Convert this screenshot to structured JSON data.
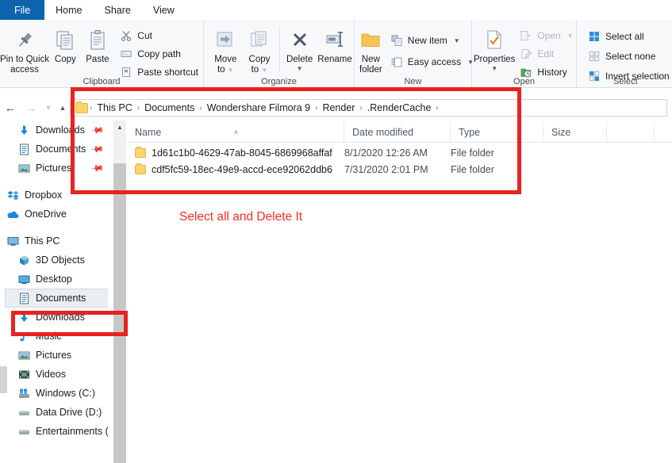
{
  "window": {
    "tabs": [
      {
        "label": "File",
        "kind": "file"
      },
      {
        "label": "Home",
        "kind": "active"
      },
      {
        "label": "Share",
        "kind": "normal"
      },
      {
        "label": "View",
        "kind": "normal"
      }
    ]
  },
  "ribbon": {
    "groups": {
      "clipboard": {
        "label": "Clipboard",
        "pin_to_quick_access_line1": "Pin to Quick",
        "pin_to_quick_access_line2": "access",
        "copy": "Copy",
        "paste": "Paste",
        "cut": "Cut",
        "copy_path": "Copy path",
        "paste_shortcut": "Paste shortcut"
      },
      "organize": {
        "label": "Organize",
        "move_to_line1": "Move",
        "move_to_line2": "to",
        "copy_to_line1": "Copy",
        "copy_to_line2": "to",
        "delete": "Delete",
        "rename": "Rename"
      },
      "new": {
        "label": "New",
        "new_folder_line1": "New",
        "new_folder_line2": "folder",
        "new_item": "New item",
        "easy_access": "Easy access"
      },
      "open": {
        "label": "Open",
        "properties": "Properties",
        "open": "Open",
        "edit": "Edit",
        "history": "History"
      },
      "select": {
        "label": "Select",
        "select_all": "Select all",
        "select_none": "Select none",
        "invert_selection": "Invert selection"
      }
    }
  },
  "address_bar": {
    "breadcrumbs": [
      "This PC",
      "Documents",
      "Wondershare Filmora 9",
      "Render",
      ".RenderCache"
    ],
    "separator": "›"
  },
  "columns": {
    "name": "Name",
    "date_modified": "Date modified",
    "type": "Type",
    "size": "Size",
    "sort_indicator": "˄"
  },
  "files": [
    {
      "name": "1d61c1b0-4629-47ab-8045-6869968affaf",
      "date_modified": "8/1/2020 12:26 AM",
      "type": "File folder",
      "size": ""
    },
    {
      "name": "cdf5fc59-18ec-49e9-accd-ece92062ddb6",
      "date_modified": "7/31/2020 2:01 PM",
      "type": "File folder",
      "size": ""
    }
  ],
  "nav_pane": {
    "quick_access": [
      {
        "label": "Downloads",
        "icon": "download-icon",
        "pinned": true,
        "indent": 1
      },
      {
        "label": "Documents",
        "icon": "document-icon",
        "pinned": true,
        "indent": 1
      },
      {
        "label": "Pictures",
        "icon": "picture-icon",
        "pinned": true,
        "indent": 1
      }
    ],
    "cloud": [
      {
        "label": "Dropbox",
        "icon": "dropbox-icon",
        "indent": 0
      },
      {
        "label": "OneDrive",
        "icon": "onedrive-icon",
        "indent": 0
      }
    ],
    "this_pc": {
      "label": "This PC",
      "icon": "monitor-icon"
    },
    "this_pc_children": [
      {
        "label": "3D Objects",
        "icon": "cube-icon",
        "selected": false
      },
      {
        "label": "Desktop",
        "icon": "desktop-icon",
        "selected": false
      },
      {
        "label": "Documents",
        "icon": "document-icon",
        "selected": true
      },
      {
        "label": "Downloads",
        "icon": "download-icon",
        "selected": false
      },
      {
        "label": "Music",
        "icon": "music-note-icon",
        "selected": false
      },
      {
        "label": "Pictures",
        "icon": "picture-icon",
        "selected": false
      },
      {
        "label": "Videos",
        "icon": "video-icon",
        "selected": false
      },
      {
        "label": "Windows (C:)",
        "icon": "windows-drive-icon",
        "selected": false
      },
      {
        "label": "Data Drive (D:)",
        "icon": "drive-icon",
        "selected": false
      },
      {
        "label": "Entertainments (",
        "icon": "drive-icon",
        "selected": false
      }
    ]
  },
  "annotations": {
    "instruction_text": "Select all and Delete It",
    "highlight_color": "#e8221f"
  }
}
